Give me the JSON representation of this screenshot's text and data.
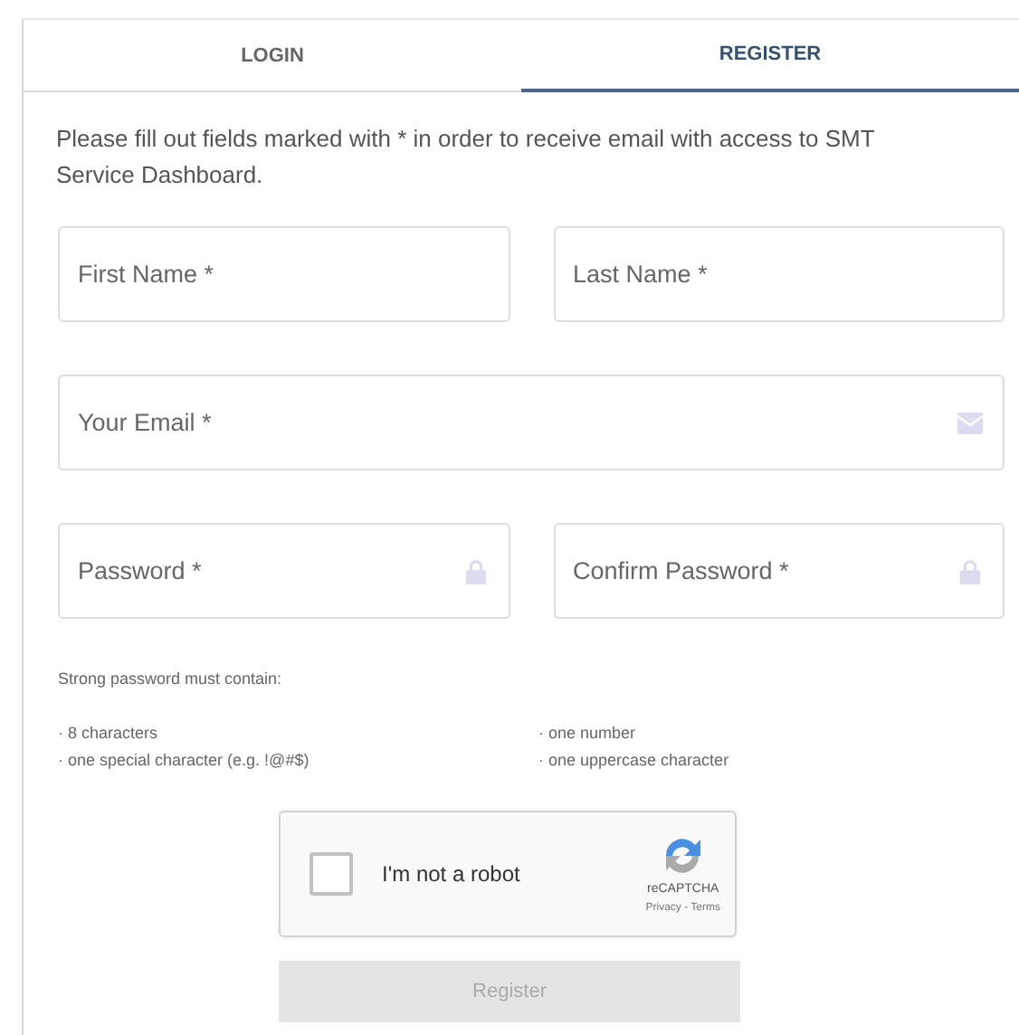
{
  "tabs": [
    {
      "label": "LOGIN",
      "selected": false
    },
    {
      "label": "REGISTER",
      "selected": true
    }
  ],
  "intro": "Please fill out fields marked with * in order to receive email with access to SMT Service Dashboard.",
  "field_rows": [
    [
      {
        "placeholder": "First Name *",
        "kind": "plain"
      },
      {
        "placeholder": "Last Name *",
        "kind": "plain"
      }
    ],
    [
      {
        "placeholder": "Your Email *",
        "kind": "email"
      }
    ],
    [
      {
        "placeholder": "Password *",
        "kind": "password"
      },
      {
        "placeholder": "Confirm Password *",
        "kind": "password"
      }
    ]
  ],
  "password_rules": {
    "heading": "Strong password must contain:",
    "columns": [
      [
        "· 8 characters",
        "· one special character (e.g. !@#$)"
      ],
      [
        "· one number",
        "· one uppercase character"
      ]
    ]
  },
  "captcha": {
    "label": "I'm not a robot",
    "checked": false,
    "brand": "reCAPTCHA",
    "links": "Privacy - Terms"
  },
  "submit": {
    "label": "Register",
    "disabled": true
  }
}
